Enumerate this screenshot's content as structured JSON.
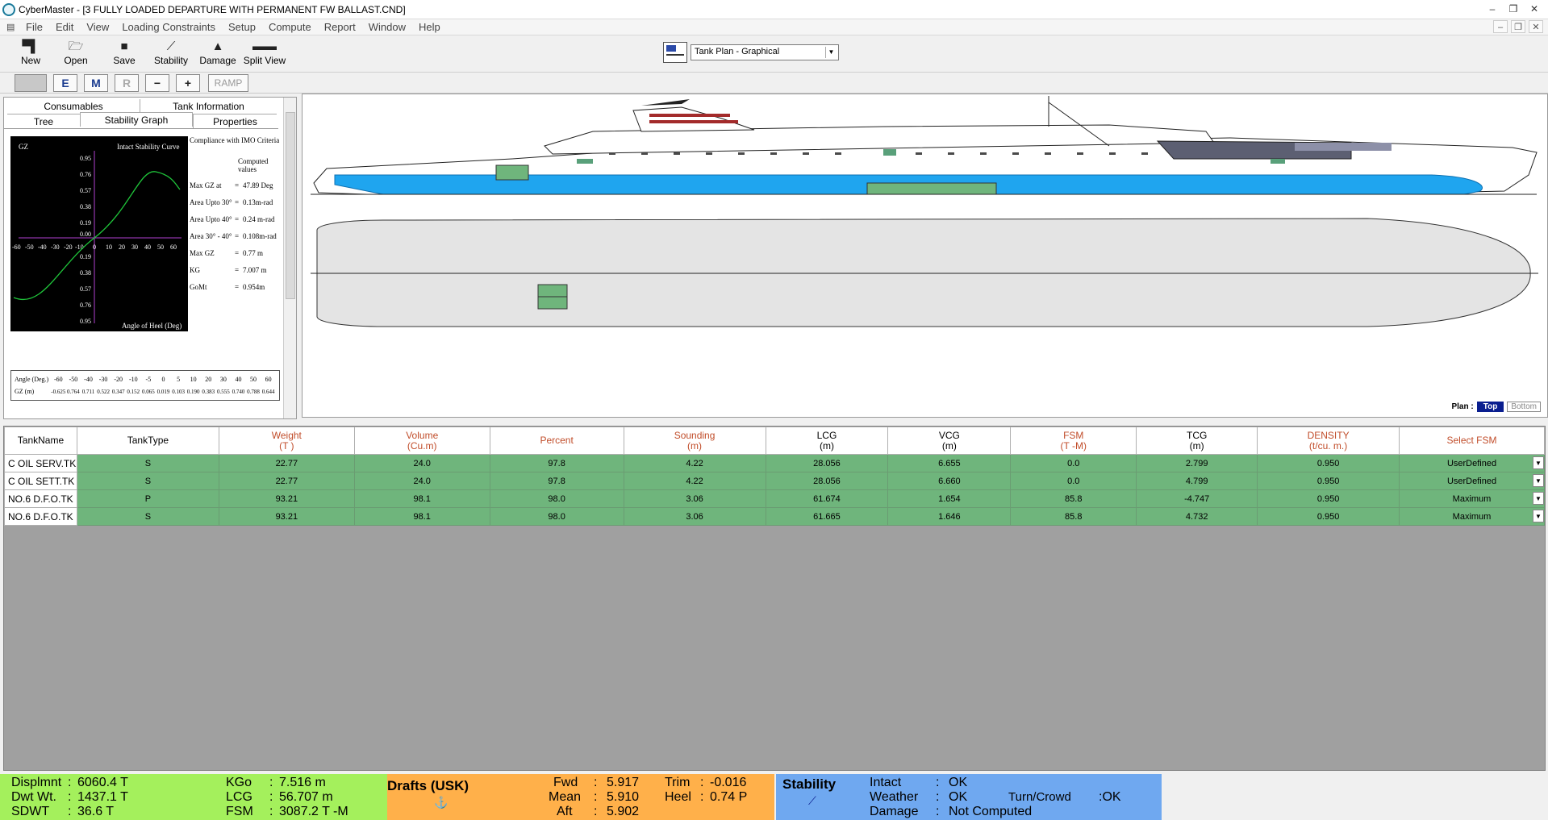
{
  "window": {
    "title": "CyberMaster - [3 FULLY LOADED DEPARTURE WITH PERMANENT FW BALLAST.CND]",
    "controls": [
      "–",
      "❐",
      "✕"
    ]
  },
  "menu": [
    "File",
    "Edit",
    "View",
    "Loading Constraints",
    "Setup",
    "Compute",
    "Report",
    "Window",
    "Help"
  ],
  "toolbar": {
    "buttons": [
      {
        "label": "New",
        "icon": "new-icon"
      },
      {
        "label": "Open",
        "icon": "open-icon"
      },
      {
        "label": "Save",
        "icon": "save-icon"
      },
      {
        "label": "Stability",
        "icon": "stability-icon"
      },
      {
        "label": "Damage",
        "icon": "damage-icon"
      },
      {
        "label": "Split View",
        "icon": "split-view-icon"
      }
    ],
    "view_select": "Tank Plan - Graphical"
  },
  "toolbar2": {
    "buttons": [
      "",
      "E",
      "M",
      "R",
      "−",
      "+",
      "RAMP"
    ]
  },
  "left_panel": {
    "tabs_row1": [
      "Consumables",
      "Tank Information"
    ],
    "tabs_row2": [
      "Tree",
      "Stability Graph",
      "Properties"
    ],
    "active_tab": "Stability Graph",
    "graph": {
      "ylabel": "GZ",
      "title": "Intact Stability Curve",
      "xlabel": "Angle of Heel (Deg)",
      "y_ticks_top": [
        "0.95",
        "0.76",
        "0.57",
        "0.38",
        "0.19",
        "0.00"
      ],
      "y_ticks_bottom": [
        "0.19",
        "0.38",
        "0.57",
        "0.76",
        "0.95"
      ],
      "x_ticks": [
        "-60",
        "-50",
        "-40",
        "-30",
        "-20",
        "-10",
        "0",
        "10",
        "20",
        "30",
        "40",
        "50",
        "60"
      ]
    },
    "compliance": {
      "heading": "Compliance with IMO Criteria",
      "sub": "Computed values",
      "rows": [
        {
          "k": "Max GZ at",
          "v": "47.89 Deg"
        },
        {
          "k": "Area Upto 30°",
          "v": "0.13m-rad"
        },
        {
          "k": "Area Upto 40°",
          "v": "0.24 m-rad"
        },
        {
          "k": "Area 30° - 40°",
          "v": "0.108m-rad"
        },
        {
          "k": "Max GZ",
          "v": "0.77 m"
        },
        {
          "k": "KG",
          "v": "7.007 m"
        },
        {
          "k": "GoMt",
          "v": "0.954m"
        }
      ]
    },
    "gz_table": {
      "row1_label": "Angle (Deg.)",
      "row1": [
        "-60",
        "-50",
        "-40",
        "-30",
        "-20",
        "-10",
        "-5",
        "0",
        "5",
        "10",
        "20",
        "30",
        "40",
        "50",
        "60"
      ],
      "row2_label": "GZ (m)",
      "row2": [
        "-0.625",
        "0.764",
        "0.711",
        "0.522",
        "0.347",
        "0.152",
        "0.065",
        "0.019",
        "0.103",
        "0.190",
        "0.383",
        "0.555",
        "0.740",
        "0.788",
        "0.644"
      ]
    }
  },
  "ship_panel": {
    "plan_label": "Plan :",
    "top_label": "Top",
    "bottom_label": "Bottom",
    "colors": {
      "hull_water": "#1fa5ef",
      "tank": "#6fb57c",
      "plan_hull": "#e4e4e4"
    }
  },
  "table": {
    "headers": [
      {
        "l1": "TankName",
        "l2": "",
        "red": false
      },
      {
        "l1": "TankType",
        "l2": "",
        "red": false
      },
      {
        "l1": "Weight",
        "l2": "(T )",
        "red": true
      },
      {
        "l1": "Volume",
        "l2": "(Cu.m)",
        "red": true
      },
      {
        "l1": "Percent",
        "l2": "",
        "red": true
      },
      {
        "l1": "Sounding",
        "l2": "(m)",
        "red": true
      },
      {
        "l1": "LCG",
        "l2": "(m)",
        "red": false
      },
      {
        "l1": "VCG",
        "l2": "(m)",
        "red": false
      },
      {
        "l1": "FSM",
        "l2": "(T -M)",
        "red": true
      },
      {
        "l1": "TCG",
        "l2": "(m)",
        "red": false
      },
      {
        "l1": "DENSITY",
        "l2": "(t/cu. m.)",
        "red": true
      },
      {
        "l1": "Select FSM",
        "l2": "",
        "red": true
      }
    ],
    "rows": [
      [
        "C OIL SERV.TK",
        "S",
        "22.77",
        "24.0",
        "97.8",
        "4.22",
        "28.056",
        "6.655",
        "0.0",
        "2.799",
        "0.950",
        "UserDefined"
      ],
      [
        "C OIL SETT.TK",
        "S",
        "22.77",
        "24.0",
        "97.8",
        "4.22",
        "28.056",
        "6.660",
        "0.0",
        "4.799",
        "0.950",
        "UserDefined"
      ],
      [
        "NO.6 D.F.O.TK",
        "P",
        "93.21",
        "98.1",
        "98.0",
        "3.06",
        "61.674",
        "1.654",
        "85.8",
        "-4.747",
        "0.950",
        "Maximum"
      ],
      [
        "NO.6 D.F.O.TK",
        "S",
        "93.21",
        "98.1",
        "98.0",
        "3.06",
        "61.665",
        "1.646",
        "85.8",
        "4.732",
        "0.950",
        "Maximum"
      ]
    ]
  },
  "status": {
    "green": [
      {
        "k": "Displmnt",
        "v": "6060.4  T"
      },
      {
        "k": "Dwt Wt.",
        "v": "1437.1  T"
      },
      {
        "k": "SDWT",
        "v": "36.6  T"
      },
      {
        "k": "KGo",
        "v": "7.516  m"
      },
      {
        "k": "LCG",
        "v": "56.707  m"
      },
      {
        "k": "FSM",
        "v": "3087.2  T -M"
      }
    ],
    "drafts_title": "Drafts (USK)",
    "drafts": [
      {
        "k": "Fwd",
        "v": "5.917"
      },
      {
        "k": "Mean",
        "v": "5.910"
      },
      {
        "k": "Aft",
        "v": "5.902"
      },
      {
        "k": "Trim",
        "v": "-0.016"
      },
      {
        "k": "Heel",
        "v": "0.74 P"
      }
    ],
    "stability_title": "Stability",
    "stability": [
      {
        "k": "Intact",
        "v": "OK"
      },
      {
        "k": "Weather",
        "v": "OK"
      },
      {
        "k": "Damage",
        "v": "Not Computed"
      },
      {
        "k": "Turn/Crowd",
        "v": ":OK"
      }
    ]
  }
}
